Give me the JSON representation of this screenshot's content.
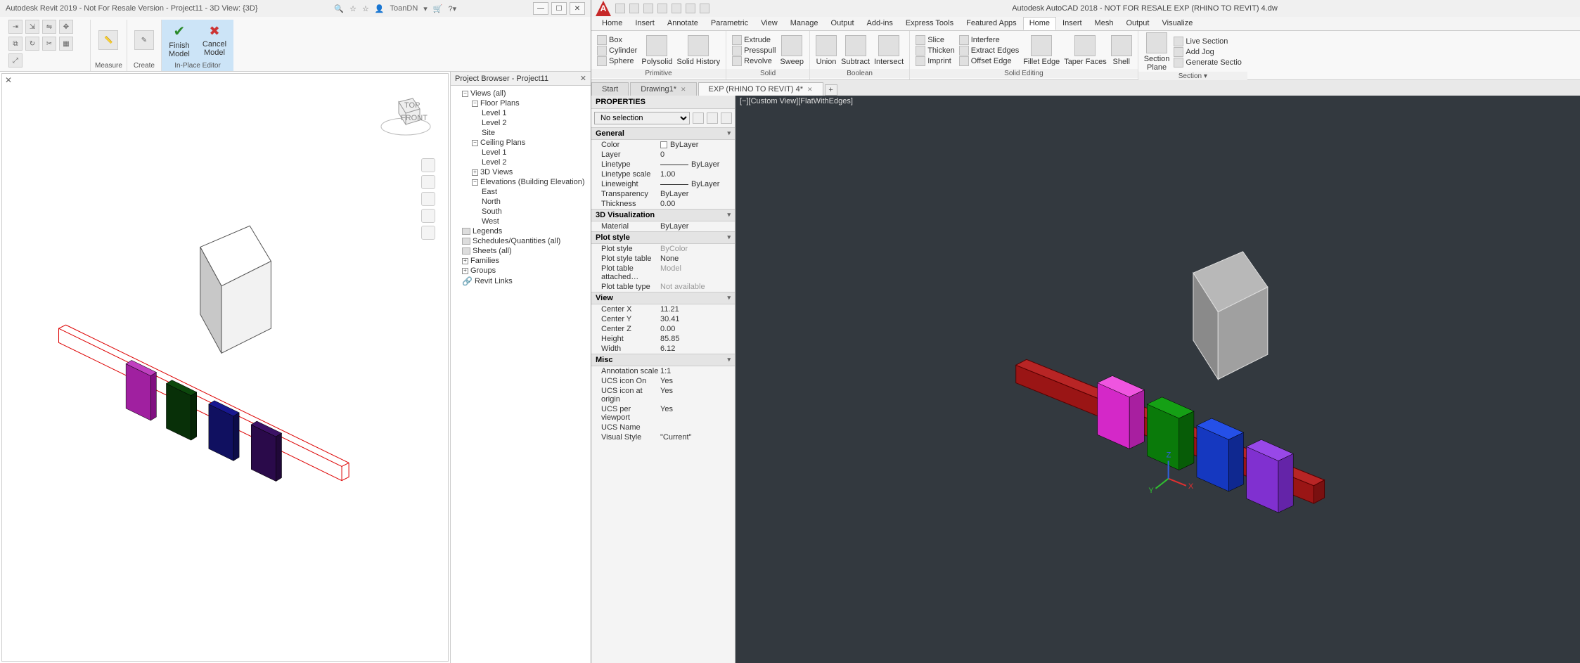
{
  "revit": {
    "title": "Autodesk Revit 2019 - Not For Resale Version - Project11 - 3D View: {3D}",
    "title_user": "ToanDN",
    "ribbon": {
      "finish": "Finish\nModel",
      "cancel": "Cancel\nModel",
      "measure": "Measure",
      "create": "Create",
      "inplace": "In-Place Editor"
    },
    "browser": {
      "title": "Project Browser - Project11",
      "root": "Views (all)",
      "floor_plans": "Floor Plans",
      "fp_items": [
        "Level 1",
        "Level 2",
        "Site"
      ],
      "ceiling_plans": "Ceiling Plans",
      "cp_items": [
        "Level 1",
        "Level 2"
      ],
      "threed": "3D Views",
      "elev": "Elevations (Building Elevation)",
      "elev_items": [
        "East",
        "North",
        "South",
        "West"
      ],
      "legends": "Legends",
      "schedules": "Schedules/Quantities (all)",
      "sheets": "Sheets (all)",
      "families": "Families",
      "groups": "Groups",
      "links": "Revit Links"
    }
  },
  "acad": {
    "title": "Autodesk AutoCAD 2018 - NOT FOR RESALE   EXP (RHINO TO REVIT) 4.dw",
    "tabs": [
      "Home",
      "Insert",
      "Annotate",
      "Parametric",
      "View",
      "Manage",
      "Output",
      "Add-ins",
      "Express Tools",
      "Featured Apps",
      "Home",
      "Insert",
      "Mesh",
      "Output",
      "Visualize"
    ],
    "active_tab_index": 10,
    "ribbon": {
      "primitive": {
        "label": "Primitive",
        "items": [
          "Box",
          "Cylinder",
          "Sphere"
        ],
        "polysolid": "Polysolid",
        "solidhist": "Solid History"
      },
      "solid": {
        "label": "Solid",
        "extrude": "Extrude",
        "presspull": "Presspull",
        "revolve": "Revolve",
        "sweep": "Sweep",
        "union": "Union",
        "subtract": "Subtract",
        "intersect": "Intersect"
      },
      "boolean": {
        "label": "Boolean"
      },
      "solidedit": {
        "label": "Solid Editing",
        "slice": "Slice",
        "thicken": "Thicken",
        "imprint": "Imprint",
        "interfere": "Interfere",
        "extractedges": "Extract Edges",
        "offsetedge": "Offset Edge",
        "filletedge": "Fillet Edge",
        "taperfaces": "Taper Faces",
        "shell": "Shell"
      },
      "section": {
        "label": "Section ▾",
        "sectionplane": "Section\nPlane",
        "livesection": "Live Section",
        "addjog": "Add Jog",
        "gensection": "Generate Sectio"
      }
    },
    "filetabs": {
      "start": "Start",
      "drawing": "Drawing1*",
      "active": "EXP (RHINO TO REVIT) 4*"
    },
    "viewlabel": "[−][Custom View][FlatWithEdges]",
    "props": {
      "title": "PROPERTIES",
      "selection": "No selection",
      "cats": {
        "general": "General",
        "threedvis": "3D Visualization",
        "plotstyle": "Plot style",
        "view": "View",
        "misc": "Misc"
      },
      "general": [
        {
          "k": "Color",
          "v": "ByLayer",
          "swatch": true
        },
        {
          "k": "Layer",
          "v": "0"
        },
        {
          "k": "Linetype",
          "v": "ByLayer",
          "line": true
        },
        {
          "k": "Linetype scale",
          "v": "1.00"
        },
        {
          "k": "Lineweight",
          "v": "ByLayer",
          "line": true
        },
        {
          "k": "Transparency",
          "v": "ByLayer"
        },
        {
          "k": "Thickness",
          "v": "0.00"
        }
      ],
      "threedvis": [
        {
          "k": "Material",
          "v": "ByLayer"
        }
      ],
      "plot": [
        {
          "k": "Plot style",
          "v": "ByColor",
          "gray": true
        },
        {
          "k": "Plot style table",
          "v": "None"
        },
        {
          "k": "Plot table attached…",
          "v": "Model",
          "gray": true
        },
        {
          "k": "Plot table type",
          "v": "Not available",
          "gray": true
        }
      ],
      "view": [
        {
          "k": "Center X",
          "v": "11.21"
        },
        {
          "k": "Center Y",
          "v": "30.41"
        },
        {
          "k": "Center Z",
          "v": "0.00"
        },
        {
          "k": "Height",
          "v": "85.85"
        },
        {
          "k": "Width",
          "v": "6.12"
        }
      ],
      "misc": [
        {
          "k": "Annotation scale",
          "v": "1:1"
        },
        {
          "k": "UCS icon On",
          "v": "Yes"
        },
        {
          "k": "UCS icon at origin",
          "v": "Yes"
        },
        {
          "k": "UCS per viewport",
          "v": "Yes"
        },
        {
          "k": "UCS Name",
          "v": ""
        },
        {
          "k": "Visual Style",
          "v": "\"Current\""
        }
      ]
    }
  }
}
